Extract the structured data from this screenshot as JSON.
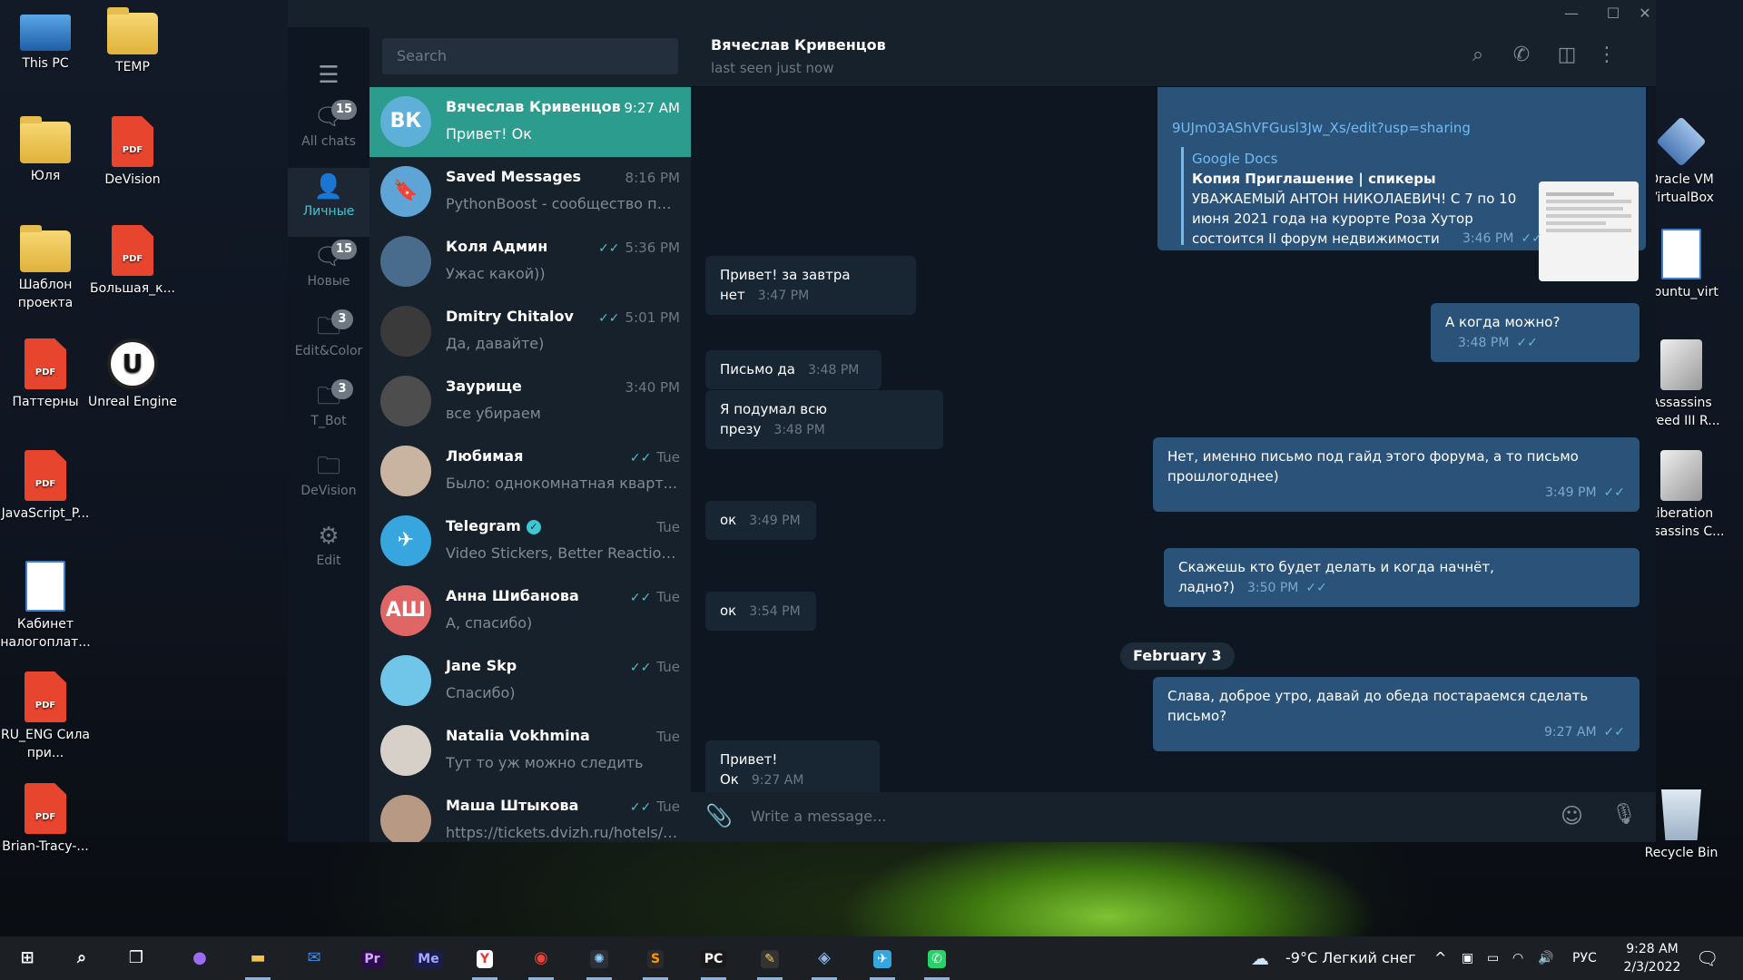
{
  "desktop": {
    "left_icons": [
      {
        "label": "This PC",
        "icon": "pc"
      },
      {
        "label": "TEMP",
        "icon": "folder"
      },
      {
        "label": "Юля",
        "icon": "folder"
      },
      {
        "label": "DeVision",
        "icon": "pdf"
      },
      {
        "label": "Шаблон проекта",
        "icon": "folder"
      },
      {
        "label": "Большая_к...",
        "icon": "pdf"
      },
      {
        "label": "Паттерны",
        "icon": "pdf"
      },
      {
        "label": "Unreal Engine",
        "icon": "ue"
      },
      {
        "label": "JavaScript_P...",
        "icon": "pdf"
      },
      {
        "label": "Кабинет налогоплат...",
        "icon": "doc"
      },
      {
        "label": "RU_ENG Сила при...",
        "icon": "pdf"
      },
      {
        "label": "Brian-Tracy-...",
        "icon": "pdf"
      }
    ],
    "right_icons": [
      {
        "label": "Oracle VM VirtualBox",
        "icon": "vbox"
      },
      {
        "label": "Ubuntu_virt",
        "icon": "doc"
      },
      {
        "label": "Assassins Creed III R...",
        "icon": "tool"
      },
      {
        "label": "Liberation Assassins C...",
        "icon": "tool"
      },
      {
        "label": "Recycle Bin",
        "icon": "bin"
      }
    ]
  },
  "window": {
    "controls": [
      "—",
      "☐",
      "✕"
    ]
  },
  "folders": {
    "items": [
      {
        "label": "All chats",
        "badge": "15",
        "icon": "chats-icon"
      },
      {
        "label": "Личные",
        "badge": "",
        "icon": "person-icon"
      },
      {
        "label": "Новые",
        "badge": "15",
        "icon": "chats-icon"
      },
      {
        "label": "Edit&Color",
        "badge": "3",
        "icon": "folder-icon"
      },
      {
        "label": "T_Bot",
        "badge": "3",
        "icon": "folder-icon"
      },
      {
        "label": "DeVision",
        "badge": "",
        "icon": "folder-icon"
      },
      {
        "label": "Edit",
        "badge": "",
        "icon": "sliders-icon"
      }
    ]
  },
  "search": {
    "placeholder": "Search"
  },
  "chats": [
    {
      "name": "Вячеслав Кривенцов",
      "initials": "ВК",
      "avatar_color": "#5fb0d9",
      "time": "9:27 AM",
      "msg": "Привет! Ок",
      "read": false,
      "selected": true
    },
    {
      "name": "Saved Messages",
      "initials": "🔖",
      "avatar_color": "#5ea4d6",
      "time": "8:16 PM",
      "msg": "PythonBoost - сообщество пит...",
      "read": false
    },
    {
      "name": "Коля Админ",
      "initials": "",
      "avatar_color": "#4a6c8c",
      "time": "5:36 PM",
      "msg": "Ужас какой))",
      "read": true
    },
    {
      "name": "Dmitry Chitalov",
      "initials": "",
      "avatar_color": "#3a3a3a",
      "time": "5:01 PM",
      "msg": "Да, давайте)",
      "read": true
    },
    {
      "name": "Заурище",
      "initials": "",
      "avatar_color": "#4d4d4d",
      "time": "3:40 PM",
      "msg": "все убираем",
      "read": false
    },
    {
      "name": "Любимая",
      "initials": "",
      "avatar_color": "#c9b4a2",
      "time": "Tue",
      "msg": "Было: однокомнатная кварт...",
      "read": true
    },
    {
      "name": "Telegram",
      "initials": "✈",
      "avatar_color": "#37a6de",
      "time": "Tue",
      "msg": "Video Stickers, Better Reactions ...",
      "read": false,
      "verified": true
    },
    {
      "name": "Анна Шибанова",
      "initials": "АШ",
      "avatar_color": "#e06666",
      "time": "Tue",
      "msg": "А, спасибо)",
      "read": true
    },
    {
      "name": "Jane Skp",
      "initials": "",
      "avatar_color": "#6fc6e8",
      "time": "Tue",
      "msg": "Спасибо)",
      "read": true
    },
    {
      "name": "Natalia Vokhmina",
      "initials": "",
      "avatar_color": "#d7d0c8",
      "time": "Tue",
      "msg": "Тут то уж можно следить",
      "read": false
    },
    {
      "name": "Маша Штыкова",
      "initials": "",
      "avatar_color": "#b89a84",
      "time": "Tue",
      "msg": "https://tickets.dvizh.ru/hotels/#/...",
      "read": true
    }
  ],
  "header": {
    "name": "Вячеслав Кривенцов",
    "status": "last seen just now"
  },
  "messages": {
    "link_text": "9UJm03AShVFGusl3Jw_Xs/edit?usp=sharing",
    "preview_site": "Google Docs",
    "preview_title": "Копия Приглашение | спикеры",
    "preview_body": "УВАЖАЕМЫЙ АНТОН НИКОЛАЕВИЧ!   С 7 по 10 июня 2021 года на курорте Роза Хутор состоится II форум недвижимости «Движение...",
    "preview_time": "3:46 PM",
    "list": [
      {
        "dir": "in",
        "text": "Привет! за завтра нет",
        "time": "3:47 PM"
      },
      {
        "dir": "out",
        "text": "А когда можно?",
        "time": "3:48 PM"
      },
      {
        "dir": "in",
        "text": "Письмо да",
        "time": "3:48 PM"
      },
      {
        "dir": "in",
        "text": "Я подумал всю презу",
        "time": "3:48 PM"
      },
      {
        "dir": "out",
        "text": "Нет, именно письмо под гайд этого форума, а то письмо прошлогоднее)",
        "time": "3:49 PM"
      },
      {
        "dir": "in",
        "text": "ок",
        "time": "3:49 PM"
      },
      {
        "dir": "out",
        "text": "Скажешь кто будет делать и когда начнёт, ладно?)",
        "time": "3:50 PM"
      },
      {
        "dir": "in",
        "text": "ок",
        "time": "3:54 PM"
      },
      {
        "dir": "out",
        "text": "Слава, доброе утро, давай до обеда постараемся сделать письмо?",
        "time": "9:27 AM"
      },
      {
        "dir": "in",
        "text": "Привет! Ок",
        "time": "9:27 AM"
      }
    ],
    "date_separator": "February 3"
  },
  "composer": {
    "placeholder": "Write a message..."
  },
  "taskbar": {
    "apps": [
      {
        "name": "windows-start-icon",
        "glyph": "⊞",
        "color": "#ffffff",
        "bg": "transparent"
      },
      {
        "name": "search-icon",
        "glyph": "⌕",
        "color": "#ffffff",
        "bg": "transparent"
      },
      {
        "name": "task-view-icon",
        "glyph": "❐",
        "color": "#ffffff",
        "bg": "transparent"
      },
      {
        "name": "alice-icon",
        "glyph": "●",
        "color": "#9b6cf0",
        "bg": "transparent"
      },
      {
        "name": "explorer-icon",
        "glyph": "▬",
        "color": "#f2c14e",
        "bg": "transparent"
      },
      {
        "name": "mail-icon",
        "glyph": "✉",
        "color": "#3b8ee6",
        "bg": "transparent"
      },
      {
        "name": "premiere-icon",
        "glyph": "Pr",
        "color": "#d9a7ff",
        "bg": "#2a0e48"
      },
      {
        "name": "media-encoder-icon",
        "glyph": "Me",
        "color": "#a4a8ff",
        "bg": "#1b1c4a"
      },
      {
        "name": "yandex-browser-icon",
        "glyph": "Y",
        "color": "#e53935",
        "bg": "#ffffff"
      },
      {
        "name": "chrome-icon",
        "glyph": "◉",
        "color": "#e8453c",
        "bg": "transparent"
      },
      {
        "name": "davinci-icon",
        "glyph": "✺",
        "color": "#8fd3ff",
        "bg": "#2b2f38"
      },
      {
        "name": "sublime-icon",
        "glyph": "S",
        "color": "#ff9800",
        "bg": "#2b2b2b"
      },
      {
        "name": "pycharm-icon",
        "glyph": "PC",
        "color": "#ffffff",
        "bg": "#1a1a1a"
      },
      {
        "name": "sketchbook-icon",
        "glyph": "✎",
        "color": "#ffcf3f",
        "bg": "#333333"
      },
      {
        "name": "virtualbox-icon",
        "glyph": "◈",
        "color": "#8db6e6",
        "bg": "transparent"
      },
      {
        "name": "telegram-icon",
        "glyph": "✈",
        "color": "#ffffff",
        "bg": "#37a6de"
      },
      {
        "name": "whatsapp-icon",
        "glyph": "✆",
        "color": "#ffffff",
        "bg": "#25d366"
      }
    ],
    "weather": "-9°C  Легкий снег",
    "lang": "РУС",
    "time": "9:28 AM",
    "date": "2/3/2022"
  }
}
